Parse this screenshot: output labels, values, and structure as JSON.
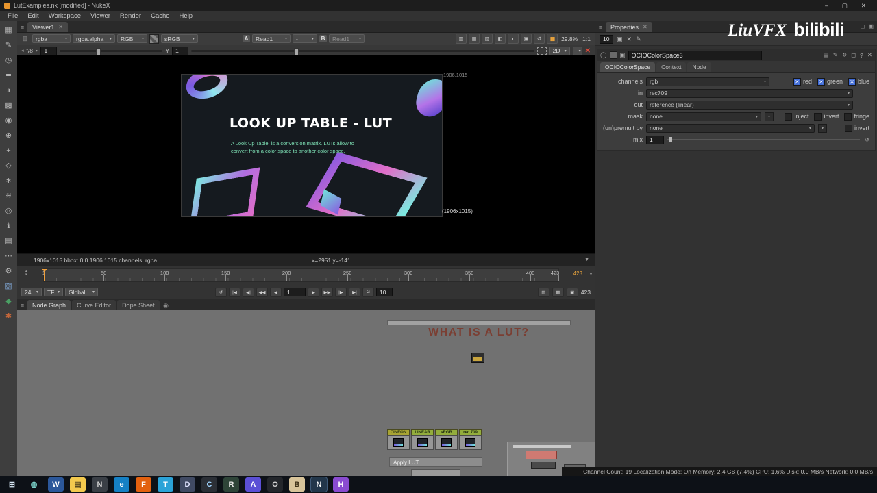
{
  "titlebar": {
    "title": "LutExamples.nk [modified] - NukeX"
  },
  "window_controls": {
    "minimize": "–",
    "maximize": "▢",
    "close": "✕"
  },
  "menu": {
    "items": [
      "File",
      "Edit",
      "Workspace",
      "Viewer",
      "Render",
      "Cache",
      "Help"
    ]
  },
  "tool_dock": {
    "icons": [
      {
        "name": "image",
        "glyph": "▦"
      },
      {
        "name": "draw",
        "glyph": "✎"
      },
      {
        "name": "time",
        "glyph": "◷"
      },
      {
        "name": "channel",
        "glyph": "≣"
      },
      {
        "name": "color",
        "glyph": "◑"
      },
      {
        "name": "filter",
        "glyph": "▩"
      },
      {
        "name": "keyer",
        "glyph": "◉"
      },
      {
        "name": "merge",
        "glyph": "⊕"
      },
      {
        "name": "transform",
        "glyph": "+"
      },
      {
        "name": "3d",
        "glyph": "◇"
      },
      {
        "name": "particles",
        "glyph": "∗"
      },
      {
        "name": "deep",
        "glyph": "≋"
      },
      {
        "name": "views",
        "glyph": "◎"
      },
      {
        "name": "metadata",
        "glyph": "ℹ"
      },
      {
        "name": "toolsets",
        "glyph": "▤"
      },
      {
        "name": "other",
        "glyph": "⋯"
      },
      {
        "name": "gizmos",
        "glyph": "⚙"
      },
      {
        "name": "ocio",
        "glyph": "▧",
        "color": "#7a9ec9"
      },
      {
        "name": "flow",
        "glyph": "◆",
        "color": "#4aa064"
      },
      {
        "name": "custom",
        "glyph": "✱",
        "color": "#c4663a"
      }
    ]
  },
  "viewer": {
    "tab": "Viewer1",
    "channels": "rgba",
    "layer": "rgba.alpha",
    "display": "RGB",
    "colorspace": "sRGB",
    "a_label": "A",
    "buffer_a": "Read1",
    "wipe_mode": "-",
    "b_label": "B",
    "buffer_b": "Read1",
    "zoom": "29.8%",
    "ratio": "1:1",
    "fstop": "f/8",
    "fstop_value": "1",
    "gamma": "Y",
    "gamma_value": "1",
    "mode2d": "2D",
    "info": "1906x1015  bbox: 0 0 1906 1015  channels: rgba",
    "coords": "x=2951 y=-141",
    "res_top": "1906,1015",
    "res_bottom": "(1906x1015)",
    "right_icons": [
      {
        "name": "wipe-icon",
        "glyph": "▥"
      },
      {
        "name": "checker-icon",
        "glyph": "▦"
      },
      {
        "name": "zebra-icon",
        "glyph": "▨"
      },
      {
        "name": "mask-overlay-icon",
        "glyph": "◧"
      },
      {
        "name": "gain-icon",
        "glyph": "◐"
      },
      {
        "name": "roi-icon",
        "glyph": "▣"
      },
      {
        "name": "refresh-icon",
        "glyph": "↺"
      },
      {
        "name": "pause-icon",
        "glyph": "▮▮",
        "accent": true
      }
    ]
  },
  "image": {
    "title": "LOOK UP TABLE - LUT",
    "description": "A Look Up Table, is a conversion matrix. LUTs allow to convert from a color space to another color space."
  },
  "timeline": {
    "ticks": [
      1,
      50,
      100,
      150,
      200,
      250,
      300,
      350,
      400,
      423
    ],
    "playhead": 1,
    "end_orange": "423",
    "end_white": "423",
    "fps": "24",
    "tf": "TF",
    "range": "Global",
    "frame": "1",
    "step": "10",
    "loop_icon": "↺",
    "transport_back": [
      {
        "name": "goto-start-button",
        "glyph": "|◀"
      },
      {
        "name": "prev-keyframe-button",
        "glyph": "◀|"
      },
      {
        "name": "fast-backward-button",
        "glyph": "◀◀"
      },
      {
        "name": "play-backward-button",
        "glyph": "◀"
      }
    ],
    "transport_fwd": [
      {
        "name": "play-forward-button",
        "glyph": "▶"
      },
      {
        "name": "fast-forward-button",
        "glyph": "▶▶"
      },
      {
        "name": "next-keyframe-button",
        "glyph": "|▶"
      },
      {
        "name": "goto-end-button",
        "glyph": "▶|"
      }
    ],
    "right_icons": [
      {
        "name": "range-lock-icon",
        "glyph": "▥"
      },
      {
        "name": "fit-range-icon",
        "glyph": "▦"
      },
      {
        "name": "lock-icon",
        "glyph": "▣"
      }
    ]
  },
  "bottom": {
    "tabs": [
      "Node Graph",
      "Curve Editor",
      "Dope Sheet"
    ]
  },
  "dag": {
    "title": "WHAT IS A LUT?",
    "backdrop": "Apply LUT",
    "nodes": [
      {
        "label": "CINEON",
        "color": "#a8a433"
      },
      {
        "label": "LINEAR",
        "color": "#93ad3c"
      },
      {
        "label": "sRGB",
        "color": "#93ad3c"
      },
      {
        "label": "rec.709",
        "color": "#93ad3c"
      }
    ]
  },
  "properties": {
    "tab": "Properties",
    "panel_count": "10",
    "toolbar_icons": [
      {
        "name": "lock-panels-icon",
        "glyph": "▣"
      },
      {
        "name": "clear-panels-icon",
        "glyph": "✕"
      },
      {
        "name": "edit-icon",
        "glyph": "✎"
      }
    ],
    "node_name": "OCIOColorSpace3",
    "header_icons": [
      {
        "name": "grid-icon",
        "glyph": "▤"
      },
      {
        "name": "pencil-icon",
        "glyph": "✎"
      },
      {
        "name": "revert-icon",
        "glyph": "↻"
      },
      {
        "name": "float-icon",
        "glyph": "◻"
      },
      {
        "name": "help-icon",
        "glyph": "?"
      },
      {
        "name": "close-icon",
        "glyph": "✕"
      }
    ],
    "tabs": [
      "OCIOColorSpace",
      "Context",
      "Node"
    ],
    "channels_label": "channels",
    "channels_value": "rgb",
    "channels_boxes": [
      {
        "label": "red",
        "checked": true
      },
      {
        "label": "green",
        "checked": true
      },
      {
        "label": "blue",
        "checked": true
      }
    ],
    "in_label": "in",
    "in_value": "rec709",
    "out_label": "out",
    "out_value": "reference (linear)",
    "mask_label": "mask",
    "mask_value": "none",
    "mask_options": [
      {
        "label": "inject",
        "checked": false
      },
      {
        "label": "invert",
        "checked": false
      },
      {
        "label": "fringe",
        "checked": false
      }
    ],
    "premult_label": "(un)premult by",
    "premult_value": "none",
    "premult_options": [
      {
        "label": "invert",
        "checked": false
      }
    ],
    "mix_label": "mix",
    "mix_value": "1"
  },
  "watermark": {
    "brand1": "LiuVFX",
    "brand2": "bilibili"
  },
  "statusbar": {
    "text": "Channel Count: 19  Localization Mode: On  Memory: 2.4 GB (7.4%)  CPU: 1.6%  Disk: 0.0 MB/s  Network: 0.0 MB/s"
  },
  "colors": {
    "accent_orange": "#ef9f3c",
    "checkbox_blue": "#3f6bd6",
    "node_green": "#93ad3c",
    "node_olive": "#a8a433",
    "dag_title": "#7b3f33",
    "backdrop_grey": "#8d8d8d",
    "pink_node": "#cf7a72"
  },
  "taskbar": {
    "icons": [
      {
        "name": "start",
        "glyph": "⊞",
        "fg": "#d7e7f4",
        "bg": "transparent"
      },
      {
        "name": "cortana",
        "glyph": "◍",
        "fg": "#7ad0c8",
        "bg": "transparent"
      },
      {
        "name": "word",
        "glyph": "W",
        "fg": "#ffffff",
        "bg": "#2b579a"
      },
      {
        "name": "file-explorer",
        "glyph": "▤",
        "fg": "#5a4a20",
        "bg": "#f3c94e"
      },
      {
        "name": "notepad",
        "glyph": "N",
        "fg": "#cfcfcf",
        "bg": "#3a3f46"
      },
      {
        "name": "edge",
        "glyph": "e",
        "fg": "#ffffff",
        "bg": "#1580c4"
      },
      {
        "name": "firefox",
        "glyph": "F",
        "fg": "#ffffff",
        "bg": "#e3610f"
      },
      {
        "name": "telegram",
        "glyph": "T",
        "fg": "#ffffff",
        "bg": "#2ba3d8"
      },
      {
        "name": "discord",
        "glyph": "D",
        "fg": "#dfe3ff",
        "bg": "#404a63"
      },
      {
        "name": "vscode",
        "glyph": "C",
        "fg": "#9fd4ff",
        "bg": "#2b2f36"
      },
      {
        "name": "resolve",
        "glyph": "R",
        "fg": "#e8e8e8",
        "bg": "#2e4438"
      },
      {
        "name": "adobe",
        "glyph": "A",
        "fg": "#ffffff",
        "bg": "#5b4fd6"
      },
      {
        "name": "obs",
        "glyph": "O",
        "fg": "#d8d8d8",
        "bg": "#23262b"
      },
      {
        "name": "blender",
        "glyph": "B",
        "fg": "#3a2d14",
        "bg": "#d8c49a"
      },
      {
        "name": "nuke",
        "glyph": "N",
        "fg": "#ffffff",
        "bg": "#4668c8",
        "active": true
      },
      {
        "name": "houdini",
        "glyph": "H",
        "fg": "#ffffff",
        "bg": "#8a4bd0"
      }
    ]
  }
}
